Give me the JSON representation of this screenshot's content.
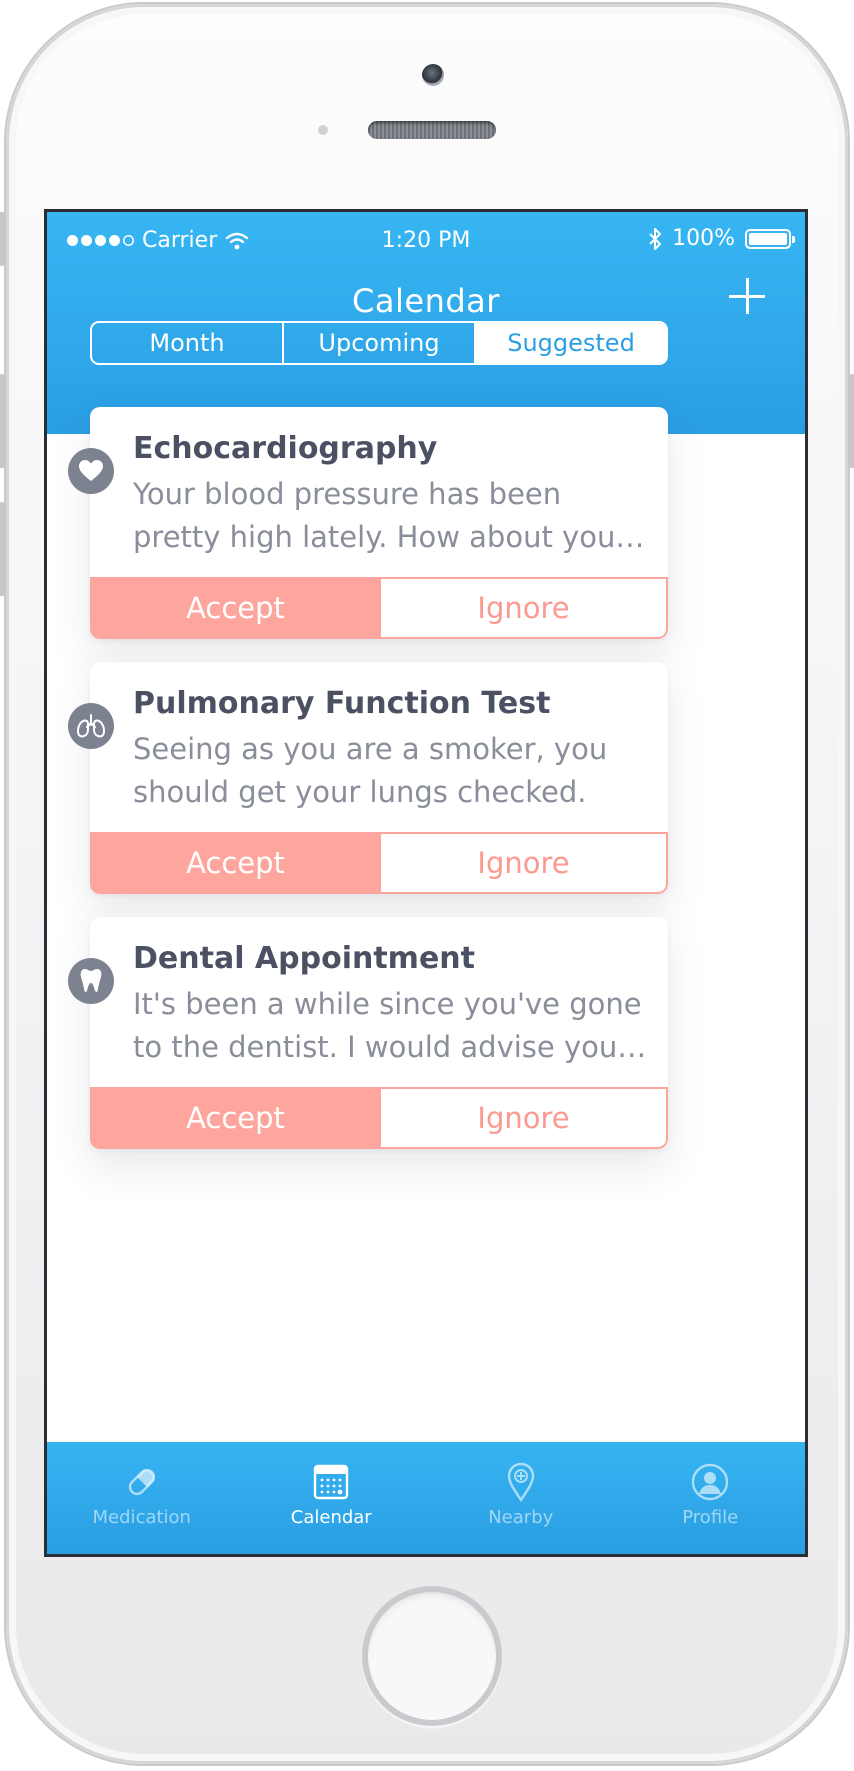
{
  "status_bar": {
    "carrier": "Carrier",
    "time": "1:20 PM",
    "battery": "100%"
  },
  "nav": {
    "title": "Calendar",
    "add_icon": "plus-icon"
  },
  "segments": [
    {
      "label": "Month",
      "active": false
    },
    {
      "label": "Upcoming",
      "active": false
    },
    {
      "label": "Suggested",
      "active": true
    }
  ],
  "suggestions": [
    {
      "icon": "heart-icon",
      "title": "Echocardiography",
      "description": "Your blood pressure has been pretty high lately. How about you…",
      "accept_label": "Accept",
      "ignore_label": "Ignore"
    },
    {
      "icon": "lungs-icon",
      "title": "Pulmonary Function Test",
      "description": "Seeing as you are a smoker, you should get your lungs checked.",
      "accept_label": "Accept",
      "ignore_label": "Ignore"
    },
    {
      "icon": "tooth-icon",
      "title": "Dental Appointment",
      "description": "It's been a while since you've gone to the dentist. I would advise you…",
      "accept_label": "Accept",
      "ignore_label": "Ignore"
    }
  ],
  "tab_bar": {
    "tabs": [
      {
        "label": "Medication",
        "icon": "pill-icon",
        "active": false
      },
      {
        "label": "Calendar",
        "icon": "calendar-icon",
        "active": true
      },
      {
        "label": "Nearby",
        "icon": "map-pin-icon",
        "active": false
      },
      {
        "label": "Profile",
        "icon": "profile-icon",
        "active": false
      }
    ]
  },
  "colors": {
    "header_blue": "#2ea4e8",
    "accept_salmon": "#fea59d",
    "ignore_text": "#fb9a90",
    "title_text": "#4b5163",
    "body_text": "#8a8e9b"
  }
}
